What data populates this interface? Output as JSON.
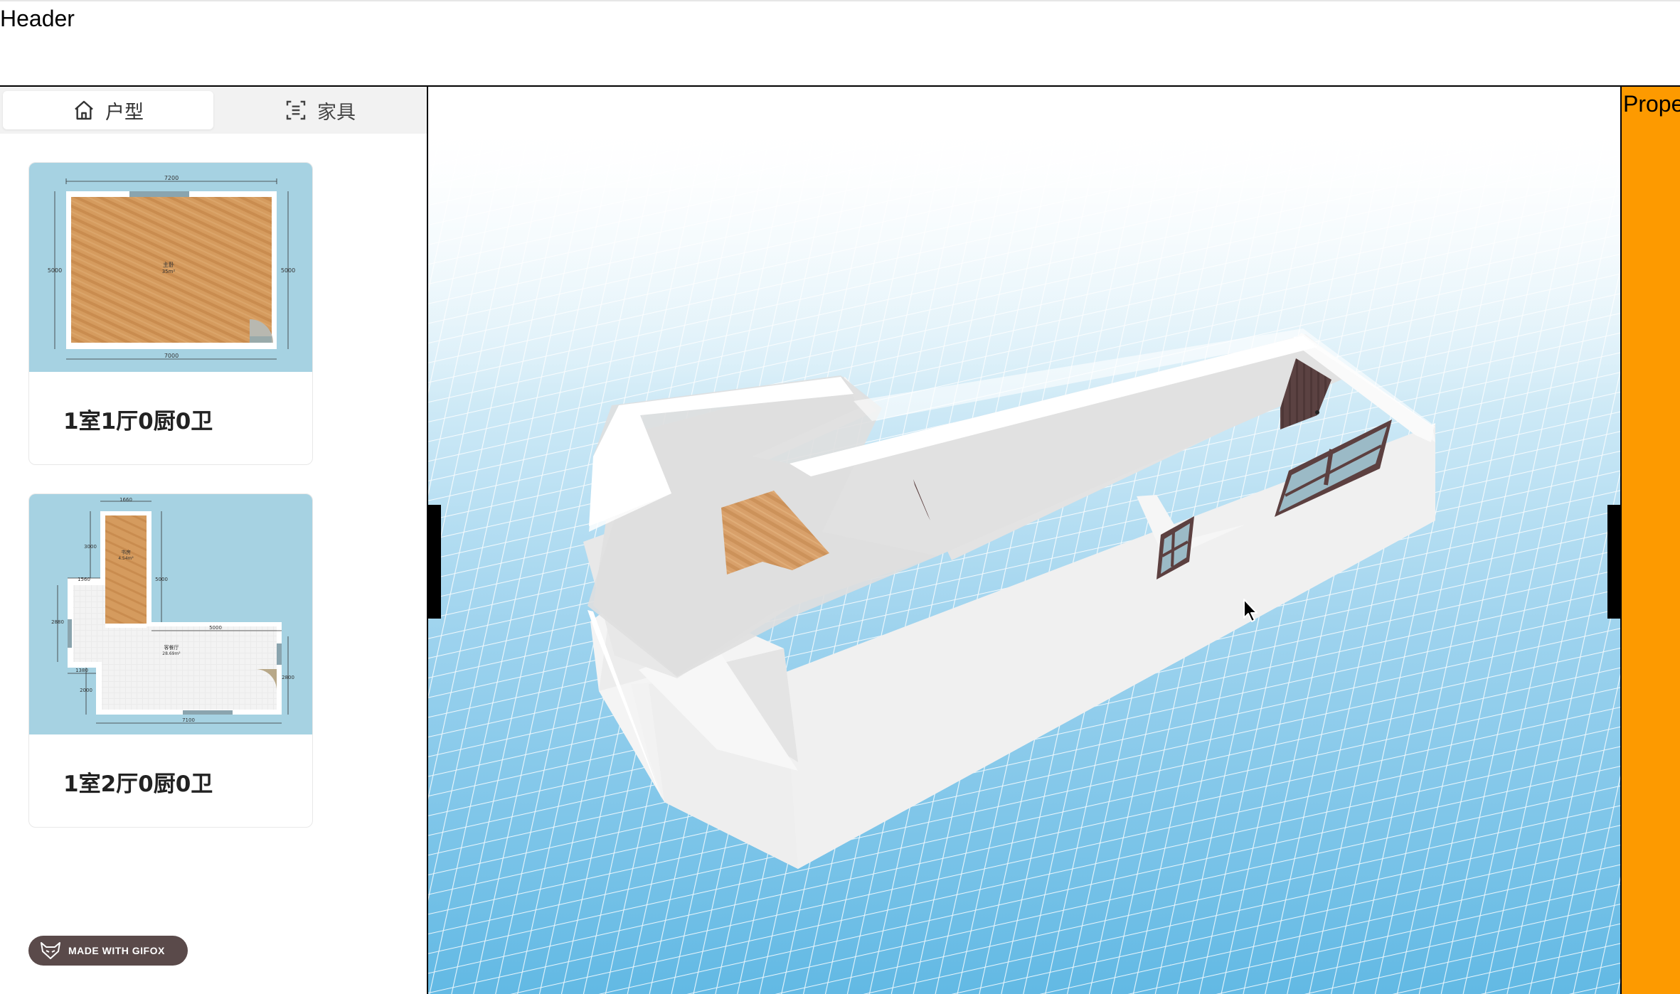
{
  "header": {
    "title": "Header"
  },
  "sidebar": {
    "tabs": [
      {
        "label": "户型",
        "icon": "home-icon",
        "active": true
      },
      {
        "label": "家具",
        "icon": "furniture-scan-icon",
        "active": false
      }
    ],
    "layouts": [
      {
        "title": "1室1厅0厨0卫",
        "plan": {
          "width_label": "7200",
          "bottom_label": "7000",
          "left_label": "5000",
          "right_label": "5000",
          "room_name": "主卧",
          "room_area": "35m²"
        }
      },
      {
        "title": "1室2厅0厨0卫",
        "plan": {
          "top_label": "1660",
          "label_3000": "3000",
          "label_5000a": "5000",
          "label_1560": "1560",
          "label_2880": "2880",
          "label_5000b": "5000",
          "label_1380": "1380",
          "label_2000": "2000",
          "label_2800": "2800",
          "bottom_label": "7100",
          "room1_name": "书房",
          "room1_area": "4.54m²",
          "room2_name": "客餐厅",
          "room2_area": "28.69m²"
        }
      }
    ],
    "badge": "MADE WITH GIFOX"
  },
  "properties": {
    "title": "Properties"
  },
  "colors": {
    "accent": "#fd9a00",
    "floor_plan_bg": "#a6d2e2",
    "grid": "#4fb3e0",
    "wood": "#d39a5c",
    "door": "#5a4040"
  }
}
